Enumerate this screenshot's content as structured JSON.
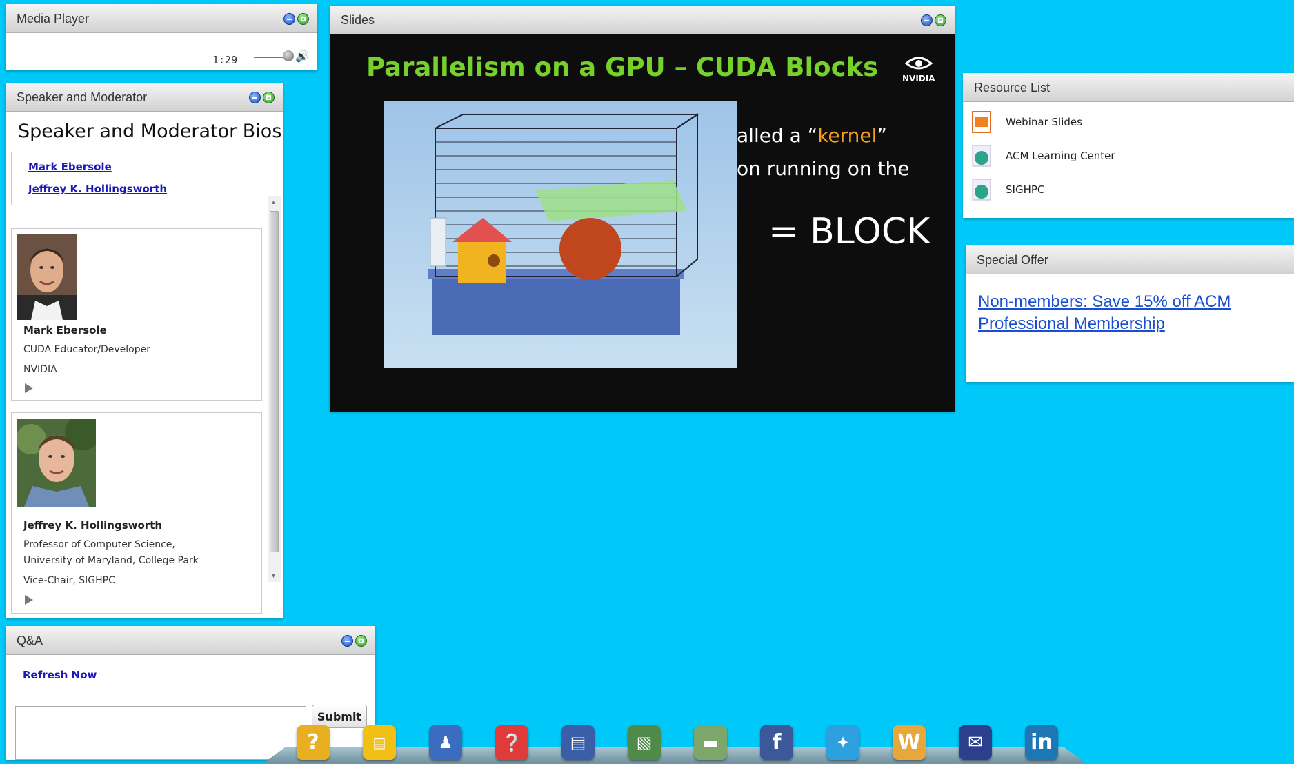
{
  "media_player": {
    "title": "Media Player",
    "time": "1:29"
  },
  "slides": {
    "title": "Slides",
    "slide_title": "Parallelism on a GPU – CUDA Blocks",
    "logo_text": "NVIDIA",
    "line1_pre": "alled a “",
    "line1_kw": "kernel",
    "line1_post": "”",
    "line2": "on running on the",
    "line3": "= BLOCK"
  },
  "speaker": {
    "title": "Speaker and Moderator",
    "heading": "Speaker and Moderator Bios",
    "links": [
      "Mark Ebersole",
      "Jeffrey K. Hollingsworth"
    ],
    "bios": [
      {
        "name": "Mark Ebersole",
        "lines": [
          "CUDA Educator/Developer",
          "NVIDIA"
        ]
      },
      {
        "name": "Jeffrey K. Hollingsworth",
        "lines": [
          "Professor of Computer Science,",
          "University of Maryland, College Park",
          "Vice-Chair, SIGHPC"
        ]
      }
    ]
  },
  "resources": {
    "title": "Resource List",
    "items": [
      "Webinar Slides",
      "ACM Learning Center",
      "SIGHPC"
    ]
  },
  "offer": {
    "title": "Special Offer",
    "link": "Non-members: Save 15% off ACM Professional Membership"
  },
  "qa": {
    "title": "Q&A",
    "refresh": "Refresh Now",
    "submit": "Submit"
  },
  "dock": {
    "help_glyph": "?",
    "facebook_glyph": "f",
    "wiki_glyph": "W",
    "linkedin_glyph": "in"
  },
  "colors": {
    "background": "#00c8f8",
    "slide_title": "#76d12a",
    "keyword": "#f6a21e",
    "link": "#1a1ab8"
  }
}
